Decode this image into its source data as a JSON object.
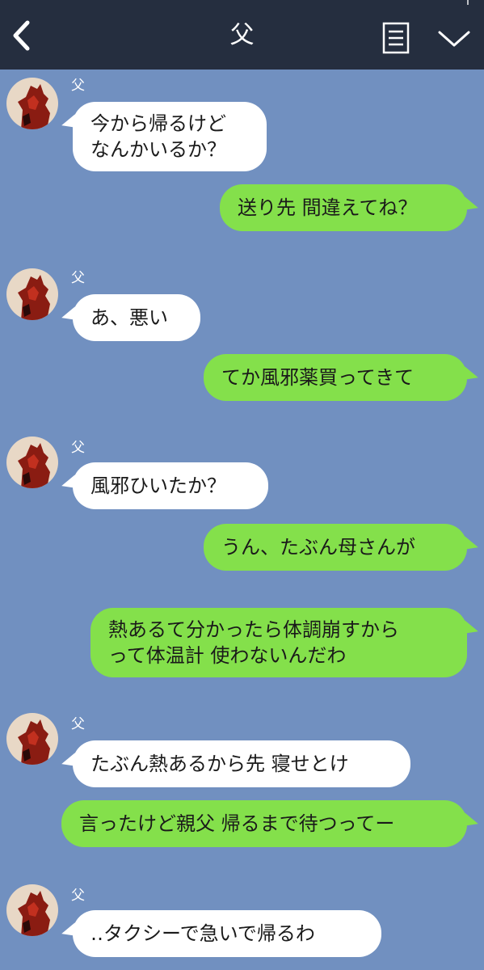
{
  "header": {
    "title": "父",
    "back_icon": "chevron-left-icon",
    "menu_icon": "notes-icon",
    "dropdown_icon": "chevron-down-icon",
    "background_color": "#252e3f"
  },
  "chat": {
    "background_color": "#7190c0",
    "incoming_bubble_color": "#ffffff",
    "outgoing_bubble_color": "#84e04b",
    "messages": [
      {
        "direction": "in",
        "sender": "父",
        "lines": [
          "今から帰るけど",
          "なんかいるか？"
        ]
      },
      {
        "direction": "out",
        "lines": [
          "送り先 間違えてね？"
        ]
      },
      {
        "direction": "in",
        "sender": "父",
        "lines": [
          "あ、悪い"
        ]
      },
      {
        "direction": "out",
        "lines": [
          "てか風邪薬買ってきて"
        ]
      },
      {
        "direction": "in",
        "sender": "父",
        "lines": [
          "風邪ひいたか？"
        ]
      },
      {
        "direction": "out",
        "lines": [
          "うん、たぶん母さんが"
        ]
      },
      {
        "direction": "out",
        "lines": [
          "熱あるて分かったら体調崩すから",
          "って体温計 使わないんだわ"
        ]
      },
      {
        "direction": "in",
        "sender": "父",
        "lines": [
          "たぶん熱あるから先 寝せとけ"
        ]
      },
      {
        "direction": "out",
        "lines": [
          "言ったけど親父 帰るまで待つってー"
        ]
      },
      {
        "direction": "in",
        "sender": "父",
        "lines": [
          "‥タクシーで急いで帰るわ"
        ]
      }
    ]
  }
}
